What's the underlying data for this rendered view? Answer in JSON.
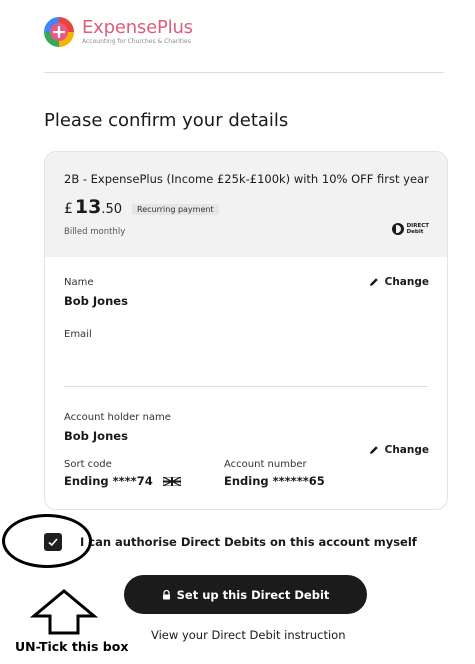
{
  "brand": {
    "name": "ExpensePlus",
    "tagline": "Accounting for Churches & Charities",
    "logo_icon": "plus-icon"
  },
  "page": {
    "heading": "Please confirm your details"
  },
  "plan": {
    "title": "2B - ExpensePlus (Income £25k-£100k) with 10% OFF first year",
    "currency": "£",
    "amount_int": "13",
    "amount_dec": ".50",
    "badge": "Recurring payment",
    "billing": "Billed monthly",
    "dd_logo_line1": "DIRECT",
    "dd_logo_line2": "Debit"
  },
  "details": {
    "name_label": "Name",
    "name_value": "Bob Jones",
    "email_label": "Email",
    "email_value": "",
    "change_label": "Change",
    "account_holder_label": "Account holder name",
    "account_holder_value": "Bob Jones",
    "sort_code_label": "Sort code",
    "sort_code_value": "Ending ****74",
    "account_number_label": "Account number",
    "account_number_value": "Ending ******65"
  },
  "consent": {
    "checked": true,
    "label": "I can authorise Direct Debits on this account myself"
  },
  "actions": {
    "submit_label": "Set up this Direct Debit",
    "view_link": "View your Direct Debit instruction"
  },
  "annotation": {
    "text": "UN-Tick this box"
  },
  "colors": {
    "brand_pink": "#df5c7d",
    "button_bg": "#1b1b1b",
    "card_header_bg": "#f2f2f2"
  }
}
